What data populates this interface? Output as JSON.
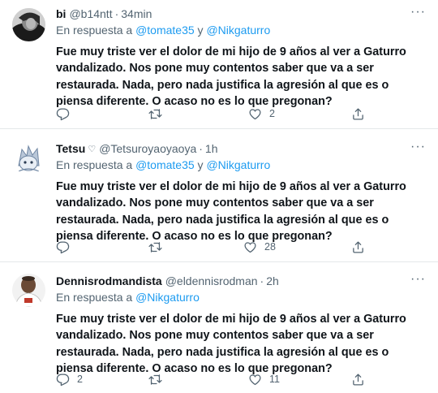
{
  "tweets": [
    {
      "name": "bi",
      "handle": "@b14ntt",
      "time": "34min",
      "reply_prefix": "En respuesta a",
      "reply_mention_1": "@tomate35",
      "reply_joiner": "y",
      "reply_mention_2": "@Nikgaturro",
      "text": "Fue muy triste ver el dolor de mi hijo de 9 años al ver a Gaturro vandalizado. Nos pone muy contentos saber que va a ser restaurada. Nada, pero nada justifica la agresión al que es o piensa diferente. O acaso no es lo que pregonan?",
      "replies": "",
      "retweets": "",
      "likes": "2"
    },
    {
      "name": "Tetsu",
      "name_badge": "♡",
      "handle": "@Tetsuroyaoyaoya",
      "time": "1h",
      "reply_prefix": "En respuesta a",
      "reply_mention_1": "@tomate35",
      "reply_joiner": "y",
      "reply_mention_2": "@Nikgaturro",
      "text": "Fue muy triste ver el dolor de mi hijo de 9 años al ver a Gaturro vandalizado. Nos pone muy contentos saber que va a ser restaurada. Nada, pero nada justifica la agresión al que es o piensa diferente. O acaso no es lo que pregonan?",
      "replies": "",
      "retweets": "",
      "likes": "28"
    },
    {
      "name": "Dennisrodmandista",
      "handle": "@eldennisrodman",
      "time": "2h",
      "reply_prefix": "En respuesta a",
      "reply_mention_1": "@Nikgaturro",
      "text": "Fue muy triste ver el dolor de mi hijo de 9 años al ver a Gaturro vandalizado. Nos pone muy contentos saber que va a ser restaurada. Nada, pero nada justifica la agresión al que es o piensa diferente. O acaso no es lo que pregonan?",
      "replies": "2",
      "retweets": "",
      "likes": "11"
    }
  ],
  "dot_separator": "·",
  "more_glyph": "···",
  "icons": {
    "reply": "reply-icon",
    "retweet": "retweet-icon",
    "like": "heart-icon",
    "share": "share-icon",
    "more": "more-icon"
  },
  "colors": {
    "text": "#0f1419",
    "secondary": "#536471",
    "link": "#1d9bf0",
    "divider": "#e4e8ea"
  }
}
